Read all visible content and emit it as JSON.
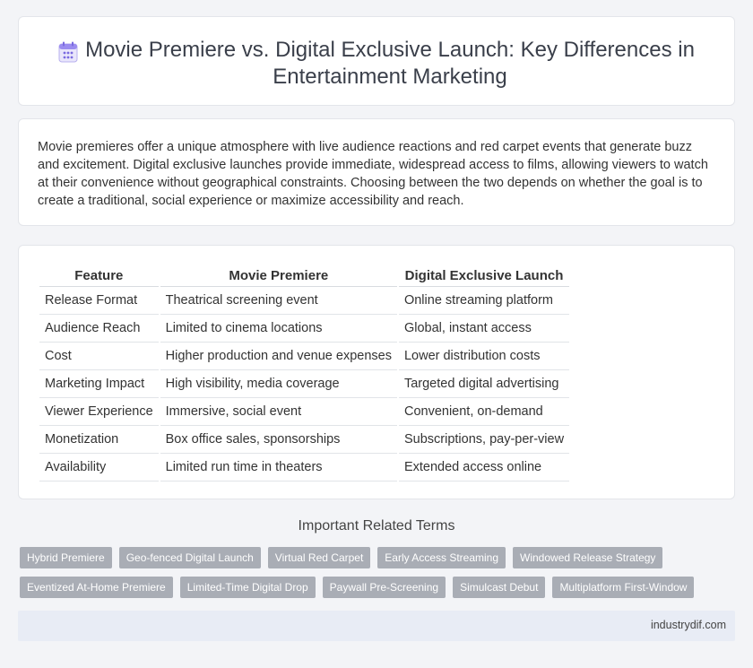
{
  "header": {
    "icon": "calendar-icon",
    "title": "Movie Premiere vs. Digital Exclusive Launch: Key Differences in Entertainment Marketing"
  },
  "summary": "Movie premieres offer a unique atmosphere with live audience reactions and red carpet events that generate buzz and excitement. Digital exclusive launches provide immediate, widespread access to films, allowing viewers to watch at their convenience without geographical constraints. Choosing between the two depends on whether the goal is to create a traditional, social experience or maximize accessibility and reach.",
  "table": {
    "headers": [
      "Feature",
      "Movie Premiere",
      "Digital Exclusive Launch"
    ],
    "rows": [
      [
        "Release Format",
        "Theatrical screening event",
        "Online streaming platform"
      ],
      [
        "Audience Reach",
        "Limited to cinema locations",
        "Global, instant access"
      ],
      [
        "Cost",
        "Higher production and venue expenses",
        "Lower distribution costs"
      ],
      [
        "Marketing Impact",
        "High visibility, media coverage",
        "Targeted digital advertising"
      ],
      [
        "Viewer Experience",
        "Immersive, social event",
        "Convenient, on-demand"
      ],
      [
        "Monetization",
        "Box office sales, sponsorships",
        "Subscriptions, pay-per-view"
      ],
      [
        "Availability",
        "Limited run time in theaters",
        "Extended access online"
      ]
    ]
  },
  "related": {
    "heading": "Important Related Terms",
    "tags_row1": [
      "Hybrid Premiere",
      "Geo-fenced Digital Launch",
      "Virtual Red Carpet",
      "Early Access Streaming",
      "Windowed Release Strategy"
    ],
    "tags_row2": [
      "Eventized At-Home Premiere",
      "Limited-Time Digital Drop",
      "Paywall Pre-Screening",
      "Simulcast Debut",
      "Multiplatform First-Window"
    ]
  },
  "footer": {
    "site": "industrydif.com"
  }
}
